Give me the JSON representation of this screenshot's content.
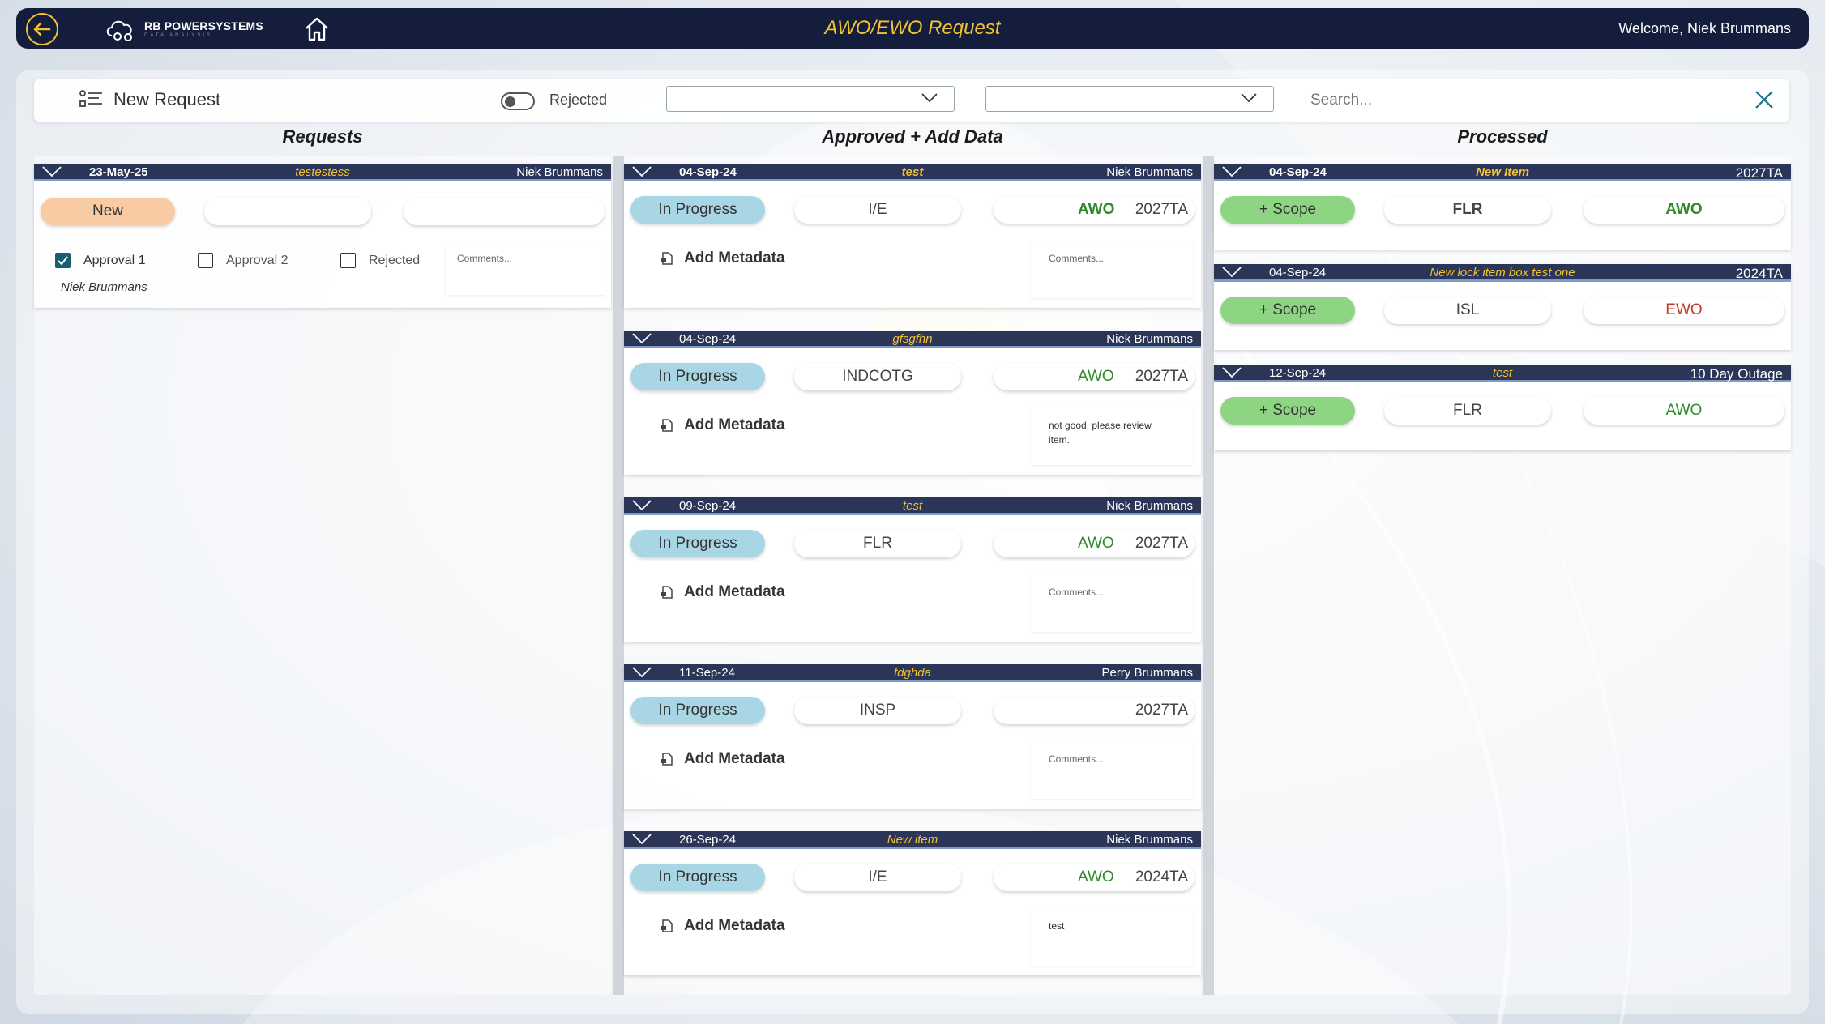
{
  "app": {
    "title": "AWO/EWO Request",
    "welcome": "Welcome, Niek Brummans",
    "logo_name": "RB POWERSYSTEMS",
    "logo_sub": "DATA ANALYSIS"
  },
  "toolbar": {
    "new_request": "New Request",
    "rejected_label": "Rejected",
    "dropdown1_value": "",
    "dropdown2_value": "",
    "search_placeholder": "Search..."
  },
  "columns": {
    "requests": "Requests",
    "approved": "Approved + Add Data",
    "processed": "Processed"
  },
  "requests": [
    {
      "date": "23-May-25",
      "title": "testestess",
      "user": "Niek Brummans",
      "status": "New",
      "approval1": "Approval 1",
      "approval2": "Approval 2",
      "rejected": "Rejected",
      "comment_placeholder": "Comments...",
      "approver": "Niek Brummans"
    }
  ],
  "approved": [
    {
      "date": "04-Sep-24",
      "title": "test",
      "user": "Niek Brummans",
      "status": "In Progress",
      "code": "I/E",
      "wo": "AWO",
      "ta": "2027TA",
      "meta": "Add Metadata",
      "comment": "Comments..."
    },
    {
      "date": "04-Sep-24",
      "title": "gfsgfhn",
      "user": "Niek Brummans",
      "status": "In Progress",
      "code": "INDCOTG",
      "wo": "AWO",
      "ta": "2027TA",
      "meta": "Add Metadata",
      "comment": "not good, please review item."
    },
    {
      "date": "09-Sep-24",
      "title": "test",
      "user": "Niek Brummans",
      "status": "In Progress",
      "code": "FLR",
      "wo": "AWO",
      "ta": "2027TA",
      "meta": "Add Metadata",
      "comment": "Comments..."
    },
    {
      "date": "11-Sep-24",
      "title": "fdghda",
      "user": "Perry Brummans",
      "status": "In Progress",
      "code": "INSP",
      "wo": "",
      "ta": "2027TA",
      "meta": "Add Metadata",
      "comment": "Comments..."
    },
    {
      "date": "26-Sep-24",
      "title": "New item",
      "user": "Niek Brummans",
      "status": "In Progress",
      "code": "I/E",
      "wo": "AWO",
      "ta": "2024TA",
      "meta": "Add Metadata",
      "comment": "test"
    }
  ],
  "processed": [
    {
      "date": "04-Sep-24",
      "title": "New Item",
      "ta": "2027TA",
      "scope": "+ Scope",
      "code": "FLR",
      "wo": "AWO"
    },
    {
      "date": "04-Sep-24",
      "title": "New lock item box test one",
      "ta": "2024TA",
      "scope": "+ Scope",
      "code": "ISL",
      "wo": "EWO"
    },
    {
      "date": "12-Sep-24",
      "title": "test",
      "ta": "10 Day Outage",
      "scope": "+ Scope",
      "code": "FLR",
      "wo": "AWO"
    }
  ],
  "colors": {
    "topbar": "#141d3b",
    "accent_yellow": "#f1c232",
    "card_header": "#2a3558",
    "status_in_progress": "#a9d6e5",
    "status_new": "#f8cba4",
    "scope_green": "#8ed583",
    "awo_green": "#2f8a2a",
    "ewo_red": "#c0392b"
  }
}
